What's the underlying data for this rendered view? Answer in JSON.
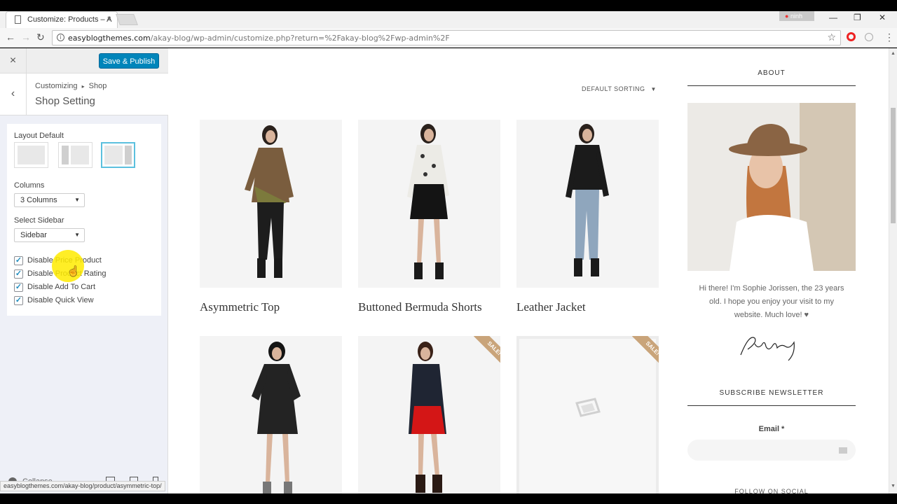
{
  "browser": {
    "tab_title": "Customize: Products – A",
    "tab_close": "×",
    "profile_name": "ninh",
    "url_host": "easyblogthemes.com",
    "url_path": "/akay-blog/wp-admin/customize.php?return=%2Fakay-blog%2Fwp-admin%2F",
    "status_url": "easyblogthemes.com/akay-blog/product/asymmetric-top/"
  },
  "customizer": {
    "close": "×",
    "publish_label": "Save & Publish",
    "back": "‹",
    "breadcrumb_root": "Customizing",
    "breadcrumb_sep": "▸",
    "breadcrumb_section": "Shop",
    "section_title": "Shop Setting",
    "layout_label": "Layout Default",
    "layout_selected": "right-sidebar",
    "columns_label": "Columns",
    "columns_value": "3 Columns",
    "sidebar_label": "Select Sidebar",
    "sidebar_value": "Sidebar",
    "checkboxes": [
      {
        "label": "Disable Price Product",
        "checked": true
      },
      {
        "label": "Disable Product Rating",
        "checked": true
      },
      {
        "label": "Disable Add To Cart",
        "checked": true
      },
      {
        "label": "Disable Quick View",
        "checked": true
      }
    ],
    "collapse_label": "Collapse"
  },
  "shop": {
    "sorting_label": "DEFAULT SORTING",
    "products": [
      {
        "title": "Asymmetric Top",
        "sale": false
      },
      {
        "title": "Buttoned Bermuda Shorts",
        "sale": false
      },
      {
        "title": "Leather Jacket",
        "sale": false
      },
      {
        "title": "",
        "sale": false
      },
      {
        "title": "",
        "sale": true
      },
      {
        "title": "",
        "sale": true
      }
    ],
    "sale_label": "SALE!"
  },
  "sidebar_widgets": {
    "about_title": "ABOUT",
    "about_text": "Hi there! I'm Sophie Jorissen, the 23 years old. I hope you enjoy your visit to my website. Much love! ♥",
    "subscribe_title": "SUBSCRIBE NEWSLETTER",
    "email_label": "Email *",
    "follow_title": "FOLLOW ON SOCIAL"
  },
  "colors": {
    "publish": "#0085ba",
    "checkbox_check": "#1e8cbe",
    "sale_ribbon": "#c9a47a",
    "customizer_bg": "#eef0f7"
  }
}
